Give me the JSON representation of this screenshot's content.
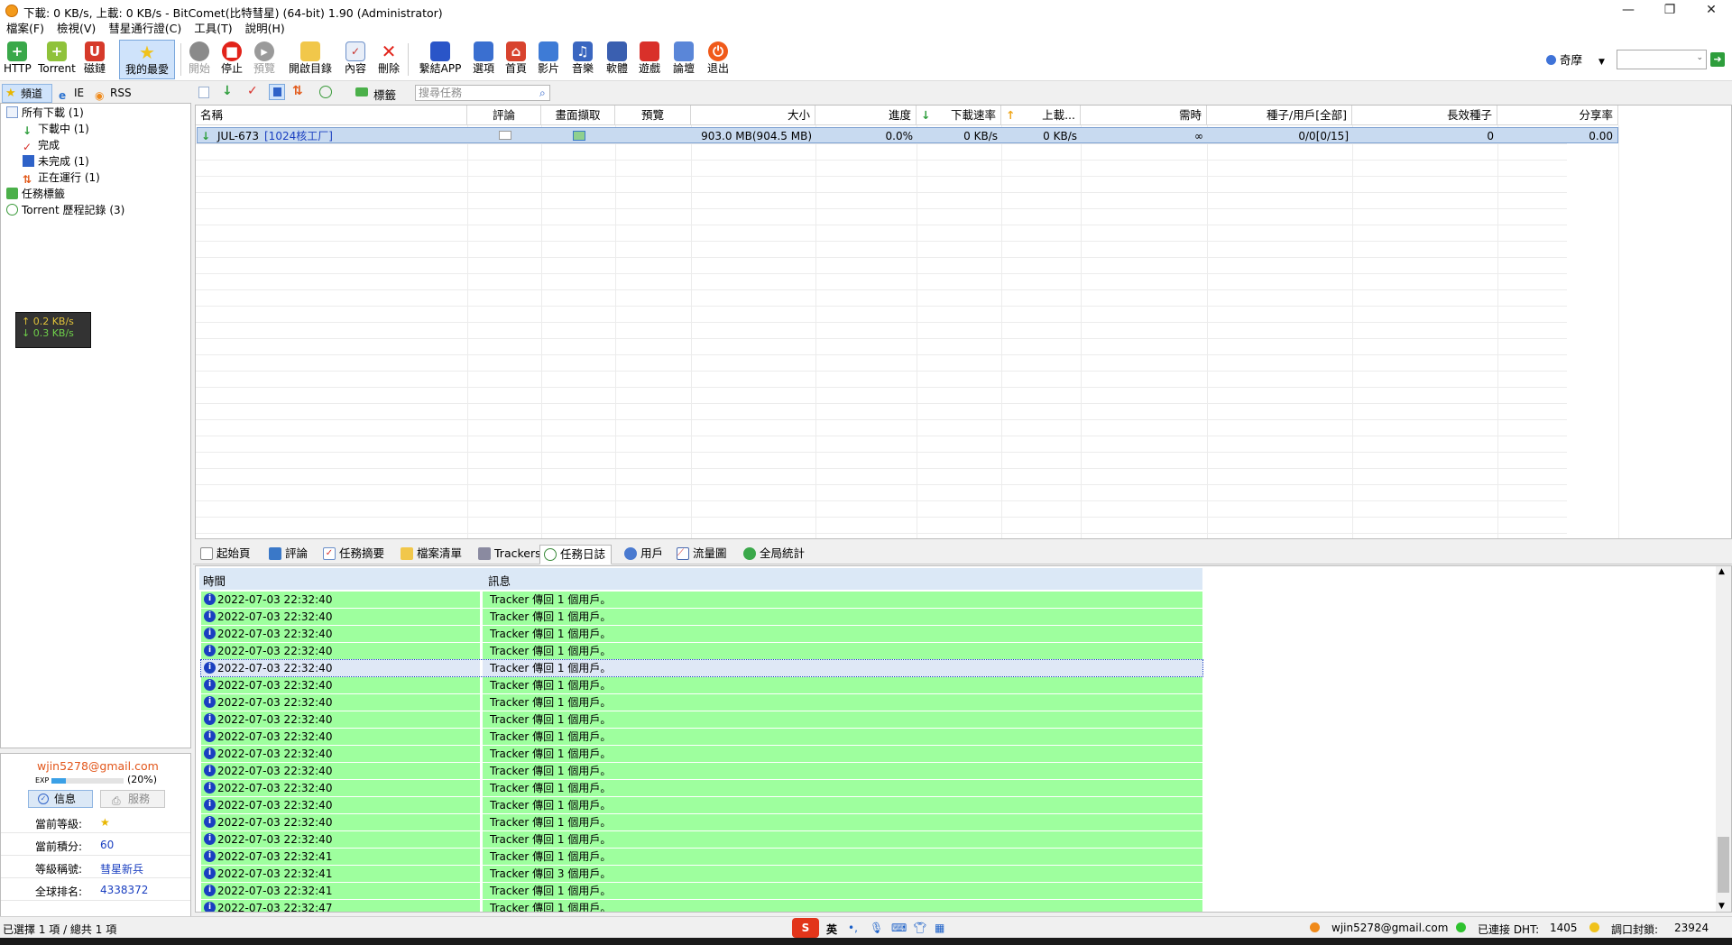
{
  "window": {
    "title": "下載: 0 KB/s,  上載: 0 KB/s - BitComet(比特彗星) (64-bit) 1.90 (Administrator)",
    "controls": {
      "minimize": "—",
      "restore": "❐",
      "close": "✕"
    }
  },
  "menu": [
    "檔案(F)",
    "檢視(V)",
    "彗星通行證(C)",
    "工具(T)",
    "說明(H)"
  ],
  "toolbar": {
    "items": [
      {
        "label": "HTTP",
        "icon": "http-add-icon"
      },
      {
        "label": "Torrent",
        "icon": "torrent-add-icon"
      },
      {
        "label": "磁鏈",
        "icon": "magnet-icon"
      },
      {
        "label": "我的最愛",
        "icon": "star-icon"
      },
      {
        "label": "開始",
        "icon": "start-icon"
      },
      {
        "label": "停止",
        "icon": "stop-icon"
      },
      {
        "label": "預覽",
        "icon": "preview-icon"
      },
      {
        "label": "開啟目錄",
        "icon": "folder-icon"
      },
      {
        "label": "內容",
        "icon": "properties-icon"
      },
      {
        "label": "刪除",
        "icon": "delete-icon"
      },
      {
        "label": "繫結APP",
        "icon": "bind-app-icon"
      },
      {
        "label": "選項",
        "icon": "options-icon"
      },
      {
        "label": "首頁",
        "icon": "home-icon"
      },
      {
        "label": "影片",
        "icon": "video-icon"
      },
      {
        "label": "音樂",
        "icon": "music-icon"
      },
      {
        "label": "軟體",
        "icon": "software-icon"
      },
      {
        "label": "遊戲",
        "icon": "game-icon"
      },
      {
        "label": "論壇",
        "icon": "forum-icon"
      },
      {
        "label": "退出",
        "icon": "exit-icon"
      }
    ],
    "search_engine": "奇摩"
  },
  "left_tabs": [
    "頻道",
    "IE",
    "RSS"
  ],
  "tree": {
    "all_downloads": "所有下載 (1)",
    "downloading": "下載中 (1)",
    "completed": "完成",
    "incomplete": "未完成 (1)",
    "running": "正在運行 (1)",
    "task_labels": "任務標籤",
    "torrent_history": "Torrent 歷程記錄 (3)"
  },
  "speed_box": {
    "up": "↑ 0.2 KB/s",
    "down": "↓ 0.3 KB/s"
  },
  "user": {
    "email": "wjin5278@gmail.com",
    "exp_label": "EXP",
    "exp_percent_text": "(20%)",
    "exp_fraction": 0.2,
    "tab_info": "信息",
    "tab_service": "服務",
    "rows": [
      {
        "key": "當前等級:",
        "value": "★"
      },
      {
        "key": "當前積分:",
        "value": "60"
      },
      {
        "key": "等級稱號:",
        "value": "彗星新兵"
      },
      {
        "key": "全球排名:",
        "value": "4338372"
      }
    ]
  },
  "list_toolbar": {
    "tag_label": "標籤",
    "search_placeholder": "搜尋任務"
  },
  "columns": [
    "名稱",
    "評論",
    "畫面擷取",
    "預覽",
    "大小",
    "進度",
    "下載速率",
    "上載...",
    "需時",
    "種子/用戶[全部]",
    "長效種子",
    "分享率"
  ],
  "task": {
    "name": "JUL-673",
    "tag": "[1024核工厂]",
    "size": "903.0 MB(904.5 MB)",
    "progress": "0.0%",
    "down_rate": "0 KB/s",
    "up_rate": "0 KB/s",
    "eta": "∞",
    "seeds_peers": "0/0[0/15]",
    "long_seeds": "0",
    "share_ratio": "0.00"
  },
  "bottom_tabs": [
    "起始頁",
    "評論",
    "任務摘要",
    "檔案清單",
    "Trackers",
    "任務日誌",
    "用戶",
    "流量圖",
    "全局統計"
  ],
  "log": {
    "headers": {
      "time": "時間",
      "message": "訊息"
    },
    "rows": [
      {
        "time": "2022-07-03 22:32:40",
        "msg": "Tracker 傳回 1 個用戶。"
      },
      {
        "time": "2022-07-03 22:32:40",
        "msg": "Tracker 傳回 1 個用戶。"
      },
      {
        "time": "2022-07-03 22:32:40",
        "msg": "Tracker 傳回 1 個用戶。"
      },
      {
        "time": "2022-07-03 22:32:40",
        "msg": "Tracker 傳回 1 個用戶。"
      },
      {
        "time": "2022-07-03 22:32:40",
        "msg": "Tracker 傳回 1 個用戶。"
      },
      {
        "time": "2022-07-03 22:32:40",
        "msg": "Tracker 傳回 1 個用戶。"
      },
      {
        "time": "2022-07-03 22:32:40",
        "msg": "Tracker 傳回 1 個用戶。"
      },
      {
        "time": "2022-07-03 22:32:40",
        "msg": "Tracker 傳回 1 個用戶。"
      },
      {
        "time": "2022-07-03 22:32:40",
        "msg": "Tracker 傳回 1 個用戶。"
      },
      {
        "time": "2022-07-03 22:32:40",
        "msg": "Tracker 傳回 1 個用戶。"
      },
      {
        "time": "2022-07-03 22:32:40",
        "msg": "Tracker 傳回 1 個用戶。"
      },
      {
        "time": "2022-07-03 22:32:40",
        "msg": "Tracker 傳回 1 個用戶。"
      },
      {
        "time": "2022-07-03 22:32:40",
        "msg": "Tracker 傳回 1 個用戶。"
      },
      {
        "time": "2022-07-03 22:32:40",
        "msg": "Tracker 傳回 1 個用戶。"
      },
      {
        "time": "2022-07-03 22:32:40",
        "msg": "Tracker 傳回 1 個用戶。"
      },
      {
        "time": "2022-07-03 22:32:41",
        "msg": "Tracker 傳回 1 個用戶。"
      },
      {
        "time": "2022-07-03 22:32:41",
        "msg": "Tracker 傳回 3 個用戶。"
      },
      {
        "time": "2022-07-03 22:32:41",
        "msg": "Tracker 傳回 1 個用戶。"
      },
      {
        "time": "2022-07-03 22:32:47",
        "msg": "Tracker 傳回 1 個用戶。"
      }
    ],
    "selected_row": 4
  },
  "status": {
    "selection": "已選擇 1 項 / 總共 1 項",
    "ime_lang": "英",
    "account": "wjin5278@gmail.com",
    "dht": "已連接 DHT:",
    "dht_count": "1405",
    "port": "調口封鎖:",
    "port_number": "23924"
  }
}
